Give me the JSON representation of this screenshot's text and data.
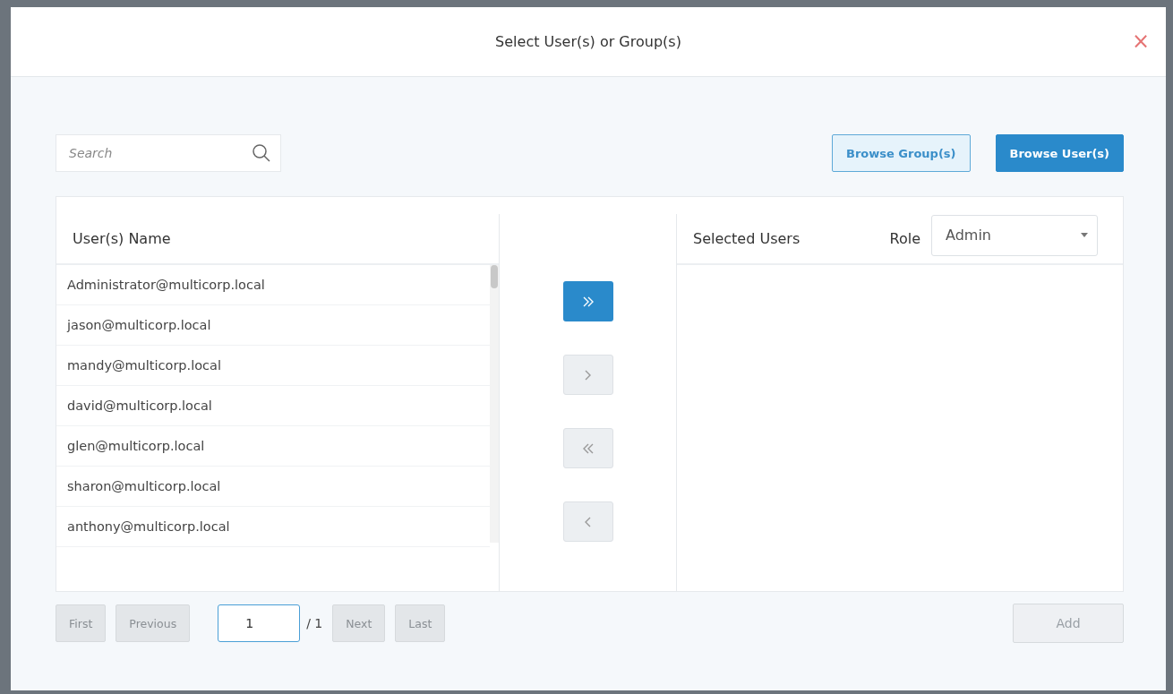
{
  "dialog": {
    "title": "Select User(s) or Group(s)",
    "close": "×"
  },
  "search": {
    "placeholder": "Search"
  },
  "browse_buttons": [
    {
      "label": "Browse Group(s)",
      "selected": false
    },
    {
      "label": "Browse User(s)",
      "selected": true
    }
  ],
  "users_table": {
    "heading": "User(s) Name",
    "rows": [
      "Administrator@multicorp.local",
      "jason@multicorp.local",
      "mandy@multicorp.local",
      "david@multicorp.local",
      "glen@multicorp.local",
      "sharon@multicorp.local",
      "anthony@multicorp.local"
    ]
  },
  "transfer_buttons": [
    {
      "kind": "add_all",
      "disabled": false
    },
    {
      "kind": "add",
      "disabled": true
    },
    {
      "kind": "remove_all",
      "disabled": true
    },
    {
      "kind": "remove",
      "disabled": true
    }
  ],
  "selected_panel": {
    "heading": "Selected Users",
    "role_label": "Role",
    "role_value": "Admin"
  },
  "pagination": {
    "first": {
      "label": "First",
      "disabled": true
    },
    "previous": {
      "label": "Previous",
      "disabled": true
    },
    "page": "1",
    "total": "/ 1",
    "next": {
      "label": "Next",
      "disabled": true
    },
    "last": {
      "label": "Last",
      "disabled": true
    }
  },
  "add_button": {
    "label": "Add",
    "disabled": true
  }
}
